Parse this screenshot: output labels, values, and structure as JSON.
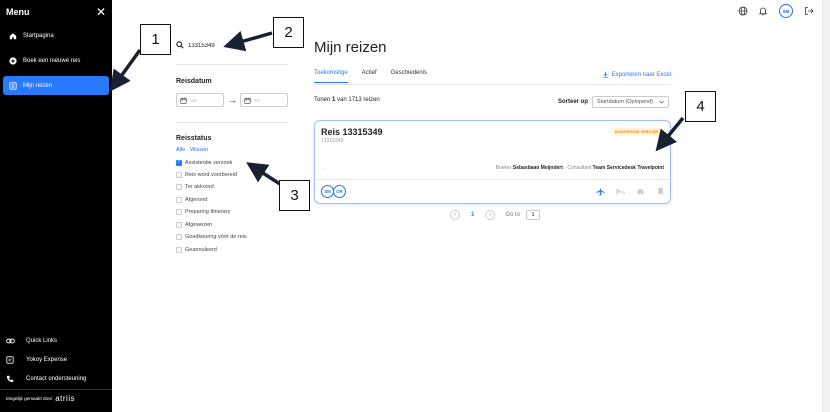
{
  "sidebar": {
    "title": "Menu",
    "close_icon": "close-icon",
    "items": [
      {
        "label": "Startpagina",
        "icon": "home-icon"
      },
      {
        "label": "Boek een nieuwe reis",
        "icon": "plus-circle-icon"
      },
      {
        "label": "Mijn reizen",
        "icon": "list-icon",
        "active": true
      }
    ],
    "footer_links": [
      {
        "label": "Quick Links",
        "icon": "link-icon"
      },
      {
        "label": "Yokoy Expense",
        "icon": "receipt-icon"
      },
      {
        "label": "Contact ondersteuning",
        "icon": "phone-icon"
      }
    ],
    "powered_by": "Mogelijk gemaakt door",
    "brand": "atriis"
  },
  "topbar": {
    "avatar_initials": "SM"
  },
  "filters": {
    "search_value": "13315349",
    "date_section_title": "Reisdatum",
    "date_from_placeholder": "Van",
    "date_to_placeholder": "Tot",
    "status_title": "Reisstatus",
    "link_all": "Alle",
    "link_clear": "Wissen",
    "statuses": [
      {
        "label": "Assistentie verzoek",
        "checked": true
      },
      {
        "label": "Reis word voorbereid",
        "checked": false
      },
      {
        "label": "Ter akkoord",
        "checked": false
      },
      {
        "label": "Afgerond",
        "checked": false
      },
      {
        "label": "Preparing Itinerary",
        "checked": false
      },
      {
        "label": "Afgewezen",
        "checked": false
      },
      {
        "label": "Goedkeuring vóór de reis",
        "checked": false
      },
      {
        "label": "Geannuleerd",
        "checked": false
      }
    ]
  },
  "main": {
    "title": "Mijn reizen",
    "tabs": [
      "Toekomstige",
      "Actief",
      "Geschiedenis"
    ],
    "export_label": "Exporteren naar Excel",
    "count_prefix": "Tonen",
    "count_shown": "1",
    "count_suffix": "van 1713 reizen",
    "sort_label": "Sorteer op",
    "sort_value": "Startdatum (Oplopend)"
  },
  "trip": {
    "title": "Reis 13315349",
    "subtitle": "13315349",
    "badge": "ASSISTENTIE VERZOEK",
    "dash": "-",
    "booker_label": "Boeker",
    "booker_name": "Sebastiaan Meijndert",
    "consultant_label": "Consultant",
    "consultant_name": "Team Servicedesk Travelpoint",
    "avatars": [
      "SM",
      "OR"
    ]
  },
  "pagination": {
    "current": "1",
    "goto_label": "Go to",
    "goto_value": "1"
  },
  "annotations": [
    "1",
    "2",
    "3",
    "4"
  ],
  "colors": {
    "accent": "#2979ff",
    "badge": "#f08a00",
    "sidebar": "#000000"
  }
}
